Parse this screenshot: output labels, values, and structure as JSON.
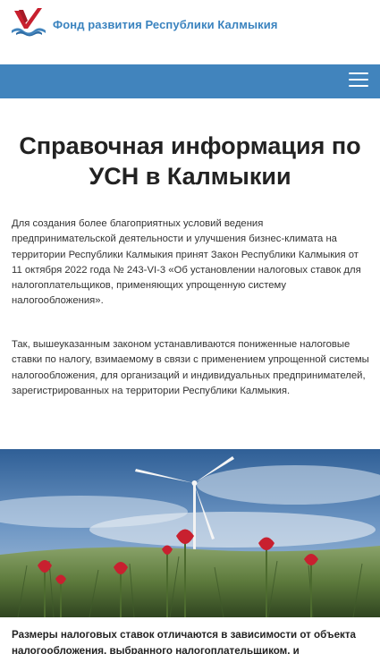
{
  "header": {
    "site_name": "Фонд развития Республики Калмыкия"
  },
  "nav": {
    "menu_icon": "hamburger-menu-icon"
  },
  "article": {
    "title": "Справочная информация по УСН в Калмыкии",
    "paragraph_1": "Для создания более благоприятных условий ведения предпринимательской деятельности и улучшения бизнес-климата на территории Республики Калмыкия принят Закон Республики Калмыкия от 11 октября 2022 года № 243-VI-3 «Об установлении налоговых ставок для налогоплательщиков, применяющих упрощенную систему налогообложения».",
    "paragraph_2": "Так, вышеуказанным законом устанавливаются пониженные налоговые ставки по налогу, взимаемому в связи с применением упрощенной системы налогообложения, для организаций и индивидуальных предпринимателей, зарегистрированных на территории Республики Калмыкия.",
    "paragraph_3": "Размеры налоговых ставок отличаются в зависимости от объекта налогообложения, выбранного налогоплательщиком, и"
  },
  "colors": {
    "brand_blue": "#4184bd",
    "logo_red": "#c8202f",
    "title_text": "#222222"
  }
}
